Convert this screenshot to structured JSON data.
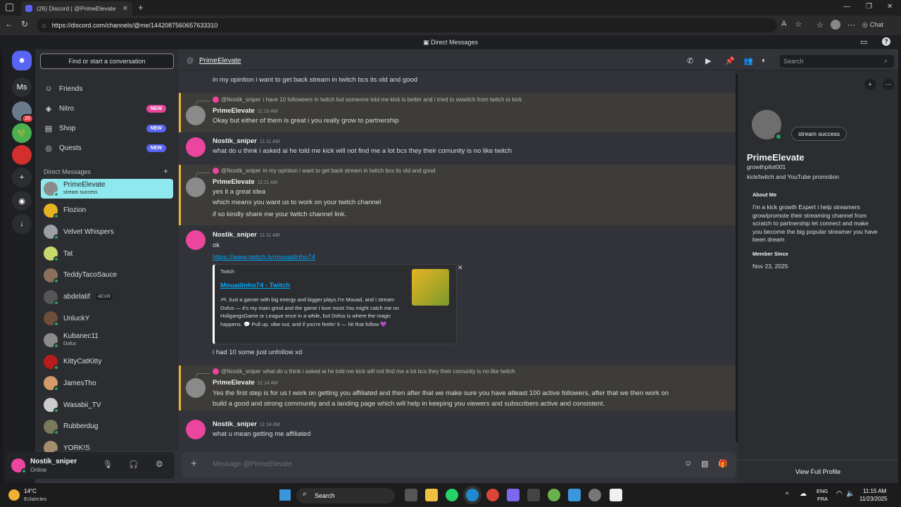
{
  "browser": {
    "tab_title": "(26) Discord | @PrimeElevate",
    "url": "https://discord.com/channels/@me/1442087560657633310",
    "chat_label": "Chat"
  },
  "discord": {
    "window_title": "Direct Messages",
    "server_badge": "26",
    "ms_label": "Ms",
    "find_conversation": "Find or start a conversation",
    "nav": [
      {
        "label": "Friends",
        "icon": "friends-icon",
        "badge": ""
      },
      {
        "label": "Nitro",
        "icon": "nitro-icon",
        "badge": "NEW"
      },
      {
        "label": "Shop",
        "icon": "shop-icon",
        "badge": "NEW"
      },
      {
        "label": "Quests",
        "icon": "quests-icon",
        "badge": "NEW"
      }
    ],
    "dm_header": "Direct Messages",
    "dms": [
      {
        "name": "PrimeElevate",
        "status": "stream success",
        "active": true
      },
      {
        "name": "Flozion",
        "status": ""
      },
      {
        "name": "Velvet Whispers",
        "status": ""
      },
      {
        "name": "Tat",
        "status": ""
      },
      {
        "name": "TeddyTacoSauce",
        "status": ""
      },
      {
        "name": "abdelatif",
        "tag": "4EVR",
        "status": ""
      },
      {
        "name": "UnluckY",
        "status": ""
      },
      {
        "name": "Kubanec11",
        "status": "Dofus"
      },
      {
        "name": "KittyCatKitty",
        "status": ""
      },
      {
        "name": "JamesTho",
        "status": ""
      },
      {
        "name": "Wasabii_TV",
        "status": ""
      },
      {
        "name": "Rubberdug",
        "status": ""
      },
      {
        "name": "YORK!S",
        "status": ""
      }
    ],
    "user": {
      "name": "Nostik_sniper",
      "status": "Online"
    },
    "channel_name": "PrimeElevate",
    "search_placeholder": "Search",
    "messages": {
      "m0": "in my opintion i want to get back stream in twitch bcs its old and good",
      "r1_user": "@Nostik_sniper",
      "r1_text": "i have 10 followeers in twitch but someone told me kick is better and i tried to swwitch from twitch to kick",
      "u1": "PrimeElevate",
      "t1": "11:10 AM",
      "m1": "Okay but either of them is great i you really grow to partnership",
      "u2": "Nostik_sniper",
      "t2": "11:11 AM",
      "m2": "what do u think i asked ai he told me kick will not find me a lot bcs they their comunity is no like twitch",
      "r3_user": "@Nostik_sniper",
      "r3_text": "in my opintion i want to get back stream in twitch bcs its old and good",
      "u3": "PrimeElevate",
      "t3": "11:11 AM",
      "m3a": "yes it a great idea",
      "m3b": "which means you want us to work on your twitch channel",
      "m3c": "if so kindly share me your twitch channel link.",
      "u4": "Nostik_sniper",
      "t4": "11:11 AM",
      "m4a": "ok",
      "m4_link": "https://www.twitch.tv/mouadinho74",
      "embed_provider": "Twitch",
      "embed_title": "Mouadinho74 - Twitch",
      "embed_desc": "🎮 Just a gamer with big energy and bigger plays.I'm Mouad, and I stream Dofus — it's my main grind and the game I love most.You might catch me on HoligangsGame or League once in a while, but Dofus is where the magic happens. 💬 Pull up, vibe out, and if you're feelin' it — hit that follow 💜",
      "m4b": "i had 10 some just unfollow xd",
      "r5_user": "@Nostik_sniper",
      "r5_text": "what do u think i asked ai he told me kick will not find me a lot bcs they their comunity is no like twitch",
      "u5": "PrimeElevate",
      "t5": "11:14 AM",
      "m5a": "Yes the first step is for us t work on getting you affiliated and then after that  we make sure you have atleast 100 active followers, after that we then work on",
      "m5b": "build a good and strong community and a landing page which will help in keeping you viewers and subscribers active and consistent.",
      "u6": "Nostik_sniper",
      "t6": "11:14 AM",
      "m6": "what u mean getting me affiliated"
    },
    "composer_placeholder": "Message @PrimeElevate",
    "profile": {
      "status_bubble": "stream success",
      "name": "PrimeElevate",
      "username": "growthpilot001",
      "pronouns": "kick/twitch and YouTube promotion",
      "about_header": "About Me",
      "about": "I'm a kick growth Expert i help streamers grow/promote their streaming channel from scratch to partnership let connect and make you become the big popular streamer you have been dream",
      "member_since_header": "Member Since",
      "member_since": "Nov 23, 2025",
      "view_full": "View Full Profile"
    }
  },
  "taskbar": {
    "weather_temp": "14°C",
    "weather_desc": "Eclaircies",
    "search": "Search",
    "lang1": "ENG",
    "lang2": "FRA",
    "time": "11:15 AM",
    "date": "11/23/2025"
  },
  "colors": {
    "accent": "#5865f2",
    "highlight": "#f0b232",
    "link": "#00a8fc",
    "online": "#23a55a",
    "active_dm": "#8ee8ed"
  }
}
